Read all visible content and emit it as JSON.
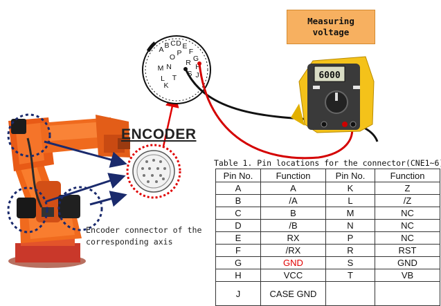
{
  "meter_label": [
    "Measuring",
    "voltage"
  ],
  "meter_display": "6000",
  "encoder_title": "ENCODER",
  "encoder_caption": [
    "Encoder connector of the",
    "corresponding axis"
  ],
  "connector_pins": [
    "A",
    "B",
    "C",
    "D",
    "E",
    "F",
    "G",
    "H",
    "J",
    "K",
    "L",
    "M",
    "N",
    "O",
    "P",
    "R",
    "S",
    "T"
  ],
  "table_caption": "Table 1. Pin locations for the connector(CNE1~6)",
  "table_headers": [
    "Pin No.",
    "Function",
    "Pin No.",
    "Function"
  ],
  "table_rows": [
    [
      "A",
      "A",
      "K",
      "Z"
    ],
    [
      "B",
      "/A",
      "L",
      "/Z"
    ],
    [
      "C",
      "B",
      "M",
      "NC"
    ],
    [
      "D",
      "/B",
      "N",
      "NC"
    ],
    [
      "E",
      "RX",
      "P",
      "NC"
    ],
    [
      "F",
      "/RX",
      "R",
      "RST"
    ],
    [
      "G",
      "GND",
      "S",
      "GND"
    ],
    [
      "H",
      "VCC",
      "T",
      "VB"
    ],
    [
      "J",
      "CASE GND",
      "",
      ""
    ]
  ],
  "colors": {
    "highlight": "#e00000",
    "robot": "#f26a1b",
    "label_box": "#f7b060",
    "callout_circle": "#1a2a6c"
  }
}
